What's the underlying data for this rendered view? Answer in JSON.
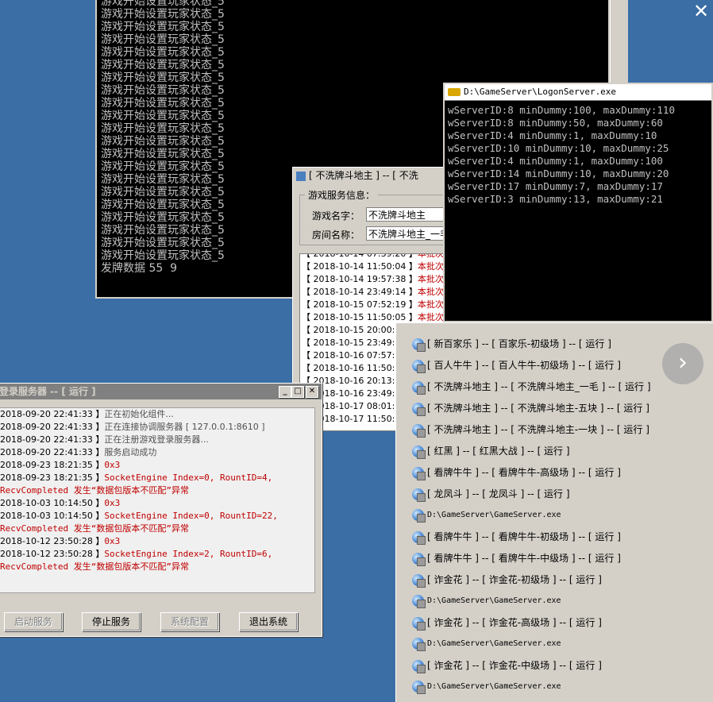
{
  "top_console": {
    "lines": [
      "游戏开始设置玩家状态_5",
      "游戏开始设置玩家状态_5",
      "游戏开始设置玩家状态_5",
      "游戏开始设置玩家状态_5",
      "游戏开始设置玩家状态_5",
      "游戏开始设置玩家状态_5",
      "游戏开始设置玩家状态_5",
      "游戏开始设置玩家状态_5",
      "游戏开始设置玩家状态_5",
      "游戏开始设置玩家状态_5",
      "游戏开始设置玩家状态_5",
      "游戏开始设置玩家状态_5",
      "游戏开始设置玩家状态_5",
      "游戏开始设置玩家状态_5",
      "游戏开始设置玩家状态_5",
      "游戏开始设置玩家状态_5",
      "游戏开始设置玩家状态_5",
      "游戏开始设置玩家状态_5",
      "游戏开始设置玩家状态_5",
      "游戏开始设置玩家状态_5",
      "游戏开始设置玩家状态_5",
      "发牌数据 55  9"
    ]
  },
  "logon_console": {
    "title": "D:\\GameServer\\LogonServer.exe",
    "lines": [
      "wServerID:8 minDummy:100, maxDummy:110",
      "wServerID:8 minDummy:50, maxDummy:60",
      "wServerID:4 minDummy:1, maxDummy:10",
      "wServerID:10 minDummy:10, maxDummy:25",
      "wServerID:4 minDummy:1, maxDummy:100",
      "wServerID:14 minDummy:10, maxDummy:20",
      "wServerID:17 minDummy:7, maxDummy:17",
      "wServerID:3 minDummy:13, maxDummy:21"
    ]
  },
  "game_window": {
    "title": "[ 不洗牌斗地主 ] -- [ 不洗",
    "group_label": "游戏服务信息：",
    "game_name_label": "游戏名字：",
    "game_name_value": "不洗牌斗地主",
    "room_name_label": "房间名称：",
    "room_name_value": "不洗牌斗地主_一毛",
    "log": [
      {
        "time": "【 2018-10-14 07:39:20 】",
        "msg": "本批次"
      },
      {
        "time": "【 2018-10-14 11:50:04 】",
        "msg": "本批次"
      },
      {
        "time": "【 2018-10-14 19:57:38 】",
        "msg": "本批次"
      },
      {
        "time": "【 2018-10-14 23:49:14 】",
        "msg": "本批次"
      },
      {
        "time": "【 2018-10-15 07:52:19 】",
        "msg": "本批次"
      },
      {
        "time": "【 2018-10-15 11:50:05 】",
        "msg": "本批次"
      },
      {
        "time": "【 2018-10-15 20:00:",
        "msg": ""
      },
      {
        "time": "【 2018-10-15 23:49:",
        "msg": ""
      },
      {
        "time": "【 2018-10-16 07:57:",
        "msg": ""
      },
      {
        "time": "【 2018-10-16 11:50:",
        "msg": ""
      },
      {
        "time": "【 2018-10-16 20:13:",
        "msg": ""
      },
      {
        "time": "【 2018-10-16 23:49:",
        "msg": ""
      },
      {
        "time": "【 2018-10-17 08:01:",
        "msg": ""
      },
      {
        "time": "【 2018-10-17 11:50:",
        "msg": ""
      }
    ]
  },
  "login_window": {
    "title": "登录服务器 -- [ 运行 ]",
    "log": [
      {
        "time": "2018-09-20 22:41:33 】",
        "msg": "正在初始化组件...",
        "color": "gray"
      },
      {
        "time": "2018-09-20 22:41:33 】",
        "msg": "正在连接协调服务器 [ 127.0.0.1:8610 ]",
        "color": "gray"
      },
      {
        "time": "2018-09-20 22:41:33 】",
        "msg": "正在注册游戏登录服务器...",
        "color": "gray"
      },
      {
        "time": "2018-09-20 22:41:33 】",
        "msg": "服务启动成功",
        "color": "gray"
      },
      {
        "time": "2018-09-23 18:21:35 】",
        "msg": "0x3",
        "color": "red"
      },
      {
        "time": "2018-09-23 18:21:35 】",
        "msg": "SocketEngine Index=0, RountID=4,",
        "color": "red"
      },
      {
        "time": "",
        "msg": "RecvCompleted 发生“数据包版本不匹配”异常",
        "color": "red"
      },
      {
        "time": "2018-10-03 10:14:50 】",
        "msg": "0x3",
        "color": "red"
      },
      {
        "time": "2018-10-03 10:14:50 】",
        "msg": "SocketEngine Index=0, RountID=22,",
        "color": "red"
      },
      {
        "time": "",
        "msg": "RecvCompleted 发生“数据包版本不匹配”异常",
        "color": "red"
      },
      {
        "time": "2018-10-12 23:50:28 】",
        "msg": "0x3",
        "color": "red"
      },
      {
        "time": "2018-10-12 23:50:28 】",
        "msg": "SocketEngine Index=2, RountID=6,",
        "color": "red"
      },
      {
        "time": "",
        "msg": "RecvCompleted 发生“数据包版本不匹配”异常",
        "color": "red"
      }
    ],
    "buttons": {
      "start": "启动服务",
      "stop": "停止服务",
      "config": "系统配置",
      "exit": "退出系统"
    }
  },
  "server_list": [
    "[ 新百家乐 ] -- [ 百家乐-初级场 ] -- [ 运行 ]",
    "[ 百人牛牛 ] -- [ 百人牛牛-初级场 ] -- [ 运行 ]",
    "[ 不洗牌斗地主 ] -- [ 不洗牌斗地主_一毛 ] -- [ 运行 ]",
    "[ 不洗牌斗地主 ] -- [ 不洗牌斗地主-五块 ] -- [ 运行 ]",
    "[ 不洗牌斗地主 ] -- [ 不洗牌斗地主-一块 ] -- [ 运行 ]",
    "[ 红黑 ] -- [ 红黑大战 ] -- [ 运行 ]",
    "[ 看牌牛牛 ] -- [ 看牌牛牛-高级场 ] -- [ 运行 ]",
    "[ 龙凤斗 ] -- [ 龙凤斗 ] -- [ 运行 ]",
    "D:\\GameServer\\GameServer.exe",
    "[ 看牌牛牛 ] -- [ 看牌牛牛-初级场 ] -- [ 运行 ]",
    "[ 看牌牛牛 ] -- [ 看牌牛牛-中级场 ] -- [ 运行 ]",
    "[ 诈金花 ] -- [ 诈金花-初级场 ] -- [ 运行 ]",
    "D:\\GameServer\\GameServer.exe",
    "[ 诈金花 ] -- [ 诈金花-高级场 ] -- [ 运行 ]",
    "D:\\GameServer\\GameServer.exe",
    "[ 诈金花 ] -- [ 诈金花-中级场 ] -- [ 运行 ]",
    "D:\\GameServer\\GameServer.exe"
  ],
  "icons": {
    "close": "✕",
    "next": "›"
  }
}
